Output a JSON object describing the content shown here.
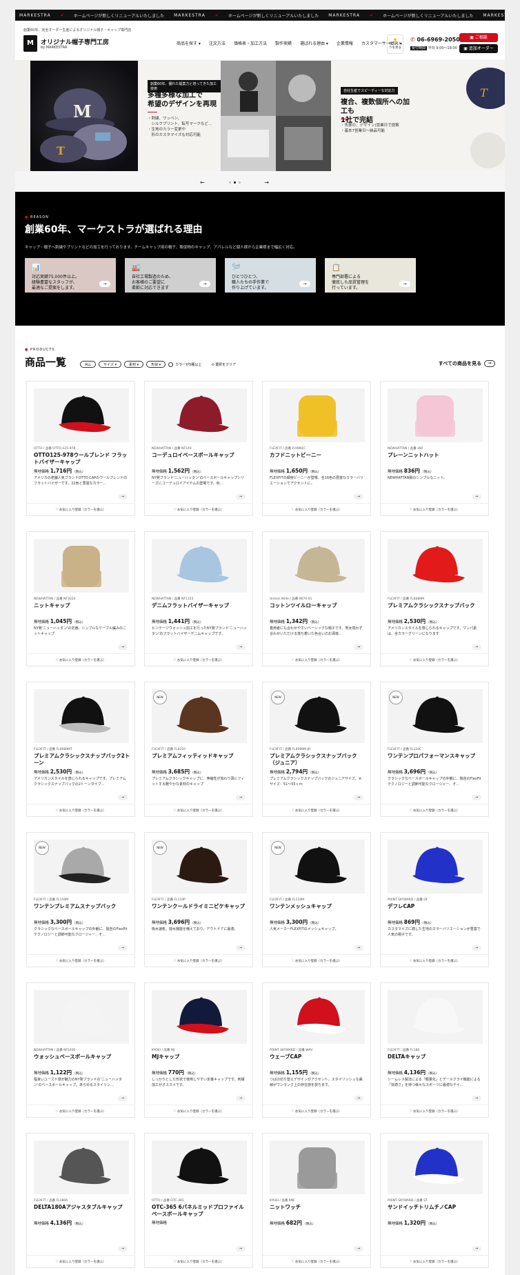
{
  "ticker": {
    "items": [
      {
        "brand": "MARKESTRA",
        "text": "ホームページが新しくリニューアルいたしました"
      },
      {
        "brand": "MARKESTRA",
        "text": "ホームページが新しくリニューアルいたしました"
      },
      {
        "brand": "MARKESTRA",
        "text": "ホームページが新しくリニューアルいたしました"
      },
      {
        "brand": "MARKESTRA",
        "text": "ホームページが新しくリニューアルいたしました"
      }
    ]
  },
  "header": {
    "tagline": "創業60年、完全オーダー生産によるオリジナル帽子・キャップ専門店",
    "site_name": "オリジナル帽子専門工房",
    "site_sub": "by MARKESTRA",
    "nav": [
      "商品を探す ▾",
      "注文方法",
      "価格表・加工方法",
      "製作実績",
      "選ばれる理由 ▾",
      "企業情報",
      "カスタマーサービス ▾"
    ],
    "fav_label": "お気に入りを見る",
    "phone": "06-6969-2050",
    "hours_badge": "受付時間",
    "hours": "平日 9:00〜18:00",
    "btn_cart": "ご相談",
    "btn_order": "追加オーダー"
  },
  "hero": {
    "slide1": {
      "badge": "創業60年、優れた提案力と培ってきた加工技術",
      "heading": [
        "多種多様な加工で",
        "希望のデザインを再現"
      ],
      "bullets": [
        "・刺繍、ワッペン、",
        "　シルクプリント、転写マークなど…",
        "・生地のカラー変更や",
        "　形のカスタマイズも対応可能"
      ]
    },
    "slide2": {
      "badge": "自社生産でスピーディーな対応力",
      "heading": [
        "複合、複数個所への加工も",
        "1社で完結"
      ],
      "bullets": [
        "・先様の、デザイン(営業日で提案",
        "・基本7営業日〜納品可能"
      ]
    },
    "pager": {
      "prev": "←",
      "next": "→",
      "active_index": 1,
      "count": 3
    }
  },
  "reason": {
    "label": "REASON",
    "title": "創業60年、マーケストラが選ばれる理由",
    "desc": "キャップ・帽子へ刺繍やプリントなどの加工を行っております。チームキャップ用の帽子、販促物のキャップ、アパレルなど個人様から企業様まで幅広く対応。",
    "cards": [
      {
        "icon": "chart-icon",
        "glyph": "📊",
        "color": "#d9c8c3",
        "lines": [
          "対応実績75,000件以上。",
          "経験豊富なスタッフが、",
          "最適なご提案をします。"
        ]
      },
      {
        "icon": "factory-icon",
        "glyph": "🏭",
        "color": "#cfcfcf",
        "lines": [
          "自社工場製造のため、",
          "お客様のご要望に",
          "柔軟に対応できます"
        ]
      },
      {
        "icon": "needle-icon",
        "glyph": "🪡",
        "color": "#d5dee2",
        "lines": [
          "ひとつひとつ、",
          "職人たちの手作業で",
          "作り上げています。"
        ]
      },
      {
        "icon": "checklist-icon",
        "glyph": "📋",
        "color": "#e9e7dc",
        "lines": [
          "専門部署による",
          "徹底した品質管理を",
          "行っています。"
        ]
      }
    ]
  },
  "products": {
    "label": "PRODUCTS",
    "title": "商品一覧",
    "filters": [
      "ALL",
      "サイズ ▾",
      "素材 ▾",
      "形状 ▾"
    ],
    "color_filter": "カラーが5種以上",
    "reset": "選択をクリア",
    "view_all": "すべての商品を見る",
    "price_label": "無地価格",
    "tax_label": "（税込）",
    "fav_text": "♡ お気に入り登録（カラーを選ぶ）",
    "new_label": "NEW",
    "items": [
      {
        "brand": "OTTO / 品番 OTTO-125-978",
        "name": "OTTO125-978ウールブレンド フラットバイザーキャップ",
        "price": "1,716",
        "desc": "アメリカの老舗人気ブランドOTTO CAPのウールブレンドのフラットバイザーです。22色と豊富なカラー…",
        "new": false,
        "cap": "#111",
        "cap2": "#d0101b"
      },
      {
        "brand": "NEWHATTAN / 品番 NF140",
        "name": "コーデュロイベースボールキャップ",
        "price": "1,562",
        "desc": "NY発ブランド'ニューハッタン'のベースボールキャップシリーズにコーデュロイアイテムの登場です。秋…",
        "new": false,
        "cap": "#8e1b2a",
        "cap2": "#8e1b2a"
      },
      {
        "brand": "FLEXFIT / 品番 FLY8N1C",
        "name": "カフドニットビーニー",
        "price": "1,650",
        "desc": "FLEXFITの細身ビーニーが登場。全16色の豊富なカラーバリエーションでアクセントに。",
        "new": false,
        "cap": "#f0c027",
        "cap2": "#f0c027"
      },
      {
        "brand": "NEWHATTAN / 品番 s60",
        "name": "プレーンニットハット",
        "price": "836",
        "desc": "NEWHATTAN製のシンプルなニット。",
        "new": false,
        "cap": "#f4c6d6",
        "cap2": "#f4c6d6"
      },
      {
        "brand": "NEWHATTAN / 品番 NF3024",
        "name": "ニットキャップ",
        "price": "1,045",
        "desc": "NY発'ニューハッタン'の定番。シンプルなケーブル編みのニットキャップ",
        "new": false,
        "cap": "#c9b288",
        "cap2": "#c9b288"
      },
      {
        "brand": "NEWHATTAN / 品番 NF1155",
        "name": "デニムフラットバイザーキャップ",
        "price": "1,441",
        "desc": "ヒンテージウォッシュ加工を行ったNY発ブランド'ニューハッタン'のフラットバイザーデニムキャップです。",
        "new": false,
        "cap": "#a9c6e0",
        "cap2": "#a9c6e0"
      },
      {
        "brand": "United Athle / 品番 9670-01",
        "name": "コットンツイルローキャップ",
        "price": "1,342",
        "desc": "着用者にも合わせやすいベーシックな帽子です。男女問わず合わせいただける落ち着いた色合いのお洒落…",
        "new": false,
        "cap": "#c5b796",
        "cap2": "#c5b796"
      },
      {
        "brand": "FLEXFIT / 品番 FL6089M",
        "name": "プレミアムクラシックスナップバック",
        "price": "2,530",
        "desc": "アメリカンスタイルを感じられるキャップです。ワンパ素は、全カラーグリーンになります",
        "new": false,
        "cap": "#e21a1a",
        "cap2": "#e21a1a"
      },
      {
        "brand": "FLEXFIT / 品番 FL6089MT",
        "name": "プレミアムクラシックスナップバック2トーン",
        "price": "2,530",
        "desc": "アメリカンスタイルを感じられるキャップです。プレミアムクラシックスナップバックの2トーンタイプ…",
        "new": false,
        "cap": "#111",
        "cap2": "#bbb"
      },
      {
        "brand": "FLEXFIT / 品番 FL6210",
        "name": "プレミアムフィッティッドキャップ",
        "price": "3,685",
        "desc": "プレミアムクラシックキャップに、伸縮性が加わり頭にフィットする軽やかな素材のキャップ",
        "new": true,
        "cap": "#5a3520",
        "cap2": "#5a3520"
      },
      {
        "brand": "FLEXFIT / 品番 FL6089M-JR",
        "name": "プレミアムクラシックスナップバック（ジュニア）",
        "price": "2,794",
        "desc": "プレミアムクラシックスナップバックのジュニアサイズ。※サイズ：51〜55ｃｍ",
        "new": true,
        "cap": "#111",
        "cap2": "#111"
      },
      {
        "brand": "FLEXFIT / 品番 FL110C",
        "name": "ワンテンプロパフォーマンスキャップ",
        "price": "3,696",
        "desc": "クラシックなベースボールキャップの外観に、独自のFlexFitテクノロジーと調節可能なクロージャー、そ…",
        "new": true,
        "cap": "#111",
        "cap2": "#111"
      },
      {
        "brand": "FLEXFIT / 品番 FL110M",
        "name": "ワンテンプレミアムスナップバック",
        "price": "3,300",
        "desc": "クラシックなベースボールキャップの外観に、独自のFlexFitテクノロジーと調節可能なクロージャー、そ…",
        "new": true,
        "cap": "#a9a9a9",
        "cap2": "#222"
      },
      {
        "brand": "FLEXFIT / 品番 FL110P",
        "name": "ワンテンクールドライミニピケキャップ",
        "price": "3,696",
        "desc": "吸水速乾、撥水機能を備えており、アウトドアに最適。",
        "new": true,
        "cap": "#2a1a12",
        "cap2": "#2a1a12"
      },
      {
        "brand": "FLEXFIT / 品番 FL110M",
        "name": "ワンテンメッシュキャップ",
        "price": "3,300",
        "desc": "人気メーカーFLEXFITのメッシュキャップ。",
        "new": true,
        "cap": "#111",
        "cap2": "#111"
      },
      {
        "brand": "POINT SKYWARD / 品番 DF",
        "name": "デフレCAP",
        "price": "869",
        "desc": "カスタマイズに適した生地のカラーバリエーションが豊富で人気の帽子です。",
        "new": false,
        "cap": "#2232c8",
        "cap2": "#2232c8"
      },
      {
        "brand": "NEWHATTAN / 品番 NF1400",
        "name": "ウォッシュベースボールキャップ",
        "price": "1,122",
        "desc": "程良いユーズド感が魅力のNY発ブランドの'ニューハッタン'のベースボールキャップ。あらゆるスタイリン…",
        "new": false,
        "cap": "#f4f4f4",
        "cap2": "#f4f4f4"
      },
      {
        "brand": "KYOEI / 品番 MJ",
        "name": "MJキャップ",
        "price": "770",
        "desc": "しっかりとした形状で使用しやすい定番キャップです。刺繍加工がオススメです。",
        "new": false,
        "cap": "#121a3a",
        "cap2": "#d0101b"
      },
      {
        "brand": "POINT SKYWARD / 品番 WAV",
        "name": "ウェーブCAP",
        "price": "1,155",
        "desc": "つばの切り替えデザインがアクセント。スタイリッシュな曲線がワンランク上の存在感を放ちます。",
        "new": false,
        "cap": "#d0101b",
        "cap2": "#fff"
      },
      {
        "brand": "FLEXFIT / 品番 FL180",
        "name": "DELTAキャップ",
        "price": "4,136",
        "desc": "シームレス製法による「軽量化」とデールクライ機能による「快適さ」を持つ様々なスポーツに最適なデイ…",
        "new": false,
        "cap": "#f8f8f8",
        "cap2": "#f8f8f8"
      },
      {
        "brand": "FLEXFIT / 品番 FL180A",
        "name": "DELTA180Aアジャスタブルキャップ",
        "price": "4,136",
        "desc": "",
        "new": false,
        "cap": "#555",
        "cap2": "#555"
      },
      {
        "brand": "OTTO / 品番 OTC-365",
        "name": "OTC-365 6パネルミッドプロファイルベースボールキャップ",
        "price": "",
        "desc": "",
        "new": false,
        "cap": "#111",
        "cap2": "#111"
      },
      {
        "brand": "KYOEI / 品番 KNF",
        "name": "ニットワッチ",
        "price": "682",
        "desc": "",
        "new": false,
        "cap": "#9a9a9a",
        "cap2": "#9a9a9a"
      },
      {
        "brand": "POINT SKYWARD / 品番 ST",
        "name": "サンドイッチトリムチノCAP",
        "price": "1,320",
        "desc": "",
        "new": false,
        "cap": "#2232c8",
        "cap2": "#fff"
      }
    ]
  }
}
